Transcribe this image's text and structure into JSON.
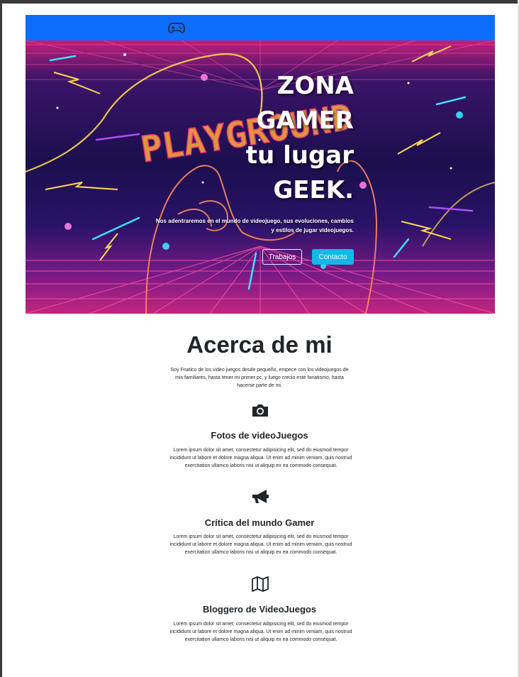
{
  "navbar": {
    "icon": "gamepad-icon"
  },
  "hero": {
    "title_lines": [
      "ZONA",
      "GAMER",
      "tu lugar",
      "GEEK."
    ],
    "background_sign": "PLAYGROUND",
    "text": "Nos adentraremos en el mundo de videojuego, sus evoluciones, cambios y estilos de jugar videojuegos.",
    "buttons": [
      {
        "label": "Trabajos",
        "style": "outline"
      },
      {
        "label": "Contacto",
        "style": "info"
      }
    ]
  },
  "about": {
    "title": "Acerca de mi",
    "text": "Soy Fnatico de los video juegos desde pequeño, empece con los videojuegos de mis familiares, hasta tener mi primer pc, y luego crecio este fanatismo, hasta hacerse parte de mi."
  },
  "features": [
    {
      "icon": "camera-icon",
      "title": "Fotos de videoJuegos",
      "text": "Lorem ipsum dolor sit amet, consectetur adipisicing elit, sed do eiusmod tempor incididunt ut labore et dolore magna aliqua. Ut enim ad minim veniam, quis nostrud exercitation ullamco laboris nisi ut aliquip ex ea commodo consequat."
    },
    {
      "icon": "megaphone-icon",
      "title": "Crítica del mundo Gamer",
      "text": "Lorem ipsum dolor sit amet, consectetur adipisicing elit, sed do eiusmod tempor incididunt ut labore et dolore magna aliqua. Ut enim ad minim veniam, quis nostrud exercitation ullamco laboris nisi ut aliquip ex ea commodo consequat."
    },
    {
      "icon": "map-icon",
      "title": "Bloggero de VideoJuegos",
      "text": "Lorem ipsum dolor sit amet, consectetur adipisicing elit, sed do eiusmod tempor incididunt ut labore et dolore magna aliqua. Ut enim ad minim veniam, quis nostrud exercitation ullamco laboris nisi ut aliquip ex ea commodo consequat."
    }
  ],
  "colors": {
    "navbar": "#0d6efd",
    "contact_button": "#14b8e6",
    "neon_pink": "#ff4fa8",
    "neon_yellow": "#ffd84a",
    "neon_cyan": "#3fe0ff",
    "text": "#212529"
  }
}
